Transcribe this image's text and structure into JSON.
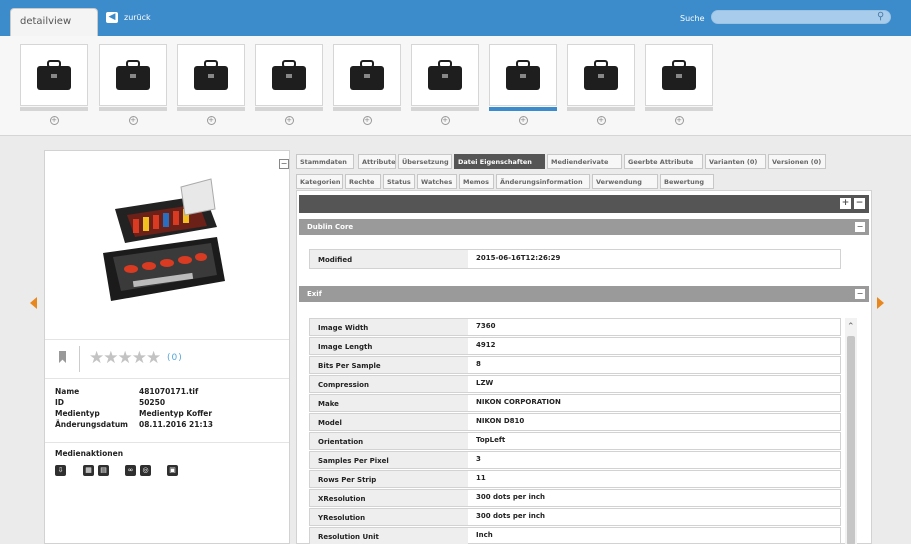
{
  "header": {
    "tab_label": "detailview",
    "back_label": "zurück",
    "search_label": "Suche",
    "search_value": ""
  },
  "thumbnails": {
    "count": 9,
    "active_index": 6
  },
  "asset": {
    "rating_value": 0,
    "rating_count": "(0)",
    "meta": [
      {
        "label": "Name",
        "value": "481070171.tif"
      },
      {
        "label": "ID",
        "value": "50250"
      },
      {
        "label": "Medientyp",
        "value": "Medientyp Koffer"
      },
      {
        "label": "Änderungsdatum",
        "value": "08.11.2016 21:13"
      }
    ],
    "actions_title": "Medienaktionen"
  },
  "tabs_row1": [
    {
      "label": "Stammdaten",
      "active": false
    },
    {
      "label": "Attribute",
      "active": false
    },
    {
      "label": "Übersetzung",
      "active": false
    },
    {
      "label": "Datei Eigenschaften",
      "active": true
    },
    {
      "label": "Medienderivate",
      "active": false
    },
    {
      "label": "Geerbte Attribute",
      "active": false
    },
    {
      "label": "Varianten (0)",
      "active": false
    },
    {
      "label": "Versionen (0)",
      "active": false
    }
  ],
  "tabs_row2": [
    {
      "label": "Kategorien",
      "active": false
    },
    {
      "label": "Rechte",
      "active": false
    },
    {
      "label": "Status",
      "active": false
    },
    {
      "label": "Watches",
      "active": false
    },
    {
      "label": "Memos",
      "active": false
    },
    {
      "label": "Änderungsinformation",
      "active": false
    },
    {
      "label": "Verwendung",
      "active": false
    },
    {
      "label": "Bewertung",
      "active": false
    }
  ],
  "dublin_core": {
    "title": "Dublin Core",
    "rows": [
      {
        "label": "Modified",
        "value": "2015-06-16T12:26:29"
      }
    ]
  },
  "exif": {
    "title": "Exif",
    "rows": [
      {
        "label": "Image Width",
        "value": "7360"
      },
      {
        "label": "Image Length",
        "value": "4912"
      },
      {
        "label": "Bits Per Sample",
        "value": "8"
      },
      {
        "label": "Compression",
        "value": "LZW"
      },
      {
        "label": "Make",
        "value": "NIKON CORPORATION"
      },
      {
        "label": "Model",
        "value": "NIKON D810"
      },
      {
        "label": "Orientation",
        "value": "TopLeft"
      },
      {
        "label": "Samples Per Pixel",
        "value": "3"
      },
      {
        "label": "Rows Per Strip",
        "value": "11"
      },
      {
        "label": "XResolution",
        "value": "300 dots per inch"
      },
      {
        "label": "YResolution",
        "value": "300 dots per inch"
      },
      {
        "label": "Resolution Unit",
        "value": "Inch"
      }
    ]
  },
  "colors": {
    "header": "#3c8bcb",
    "accent_arrow": "#e8871e",
    "active_tab": "#555555",
    "rating_blue": "#55a6d9"
  }
}
